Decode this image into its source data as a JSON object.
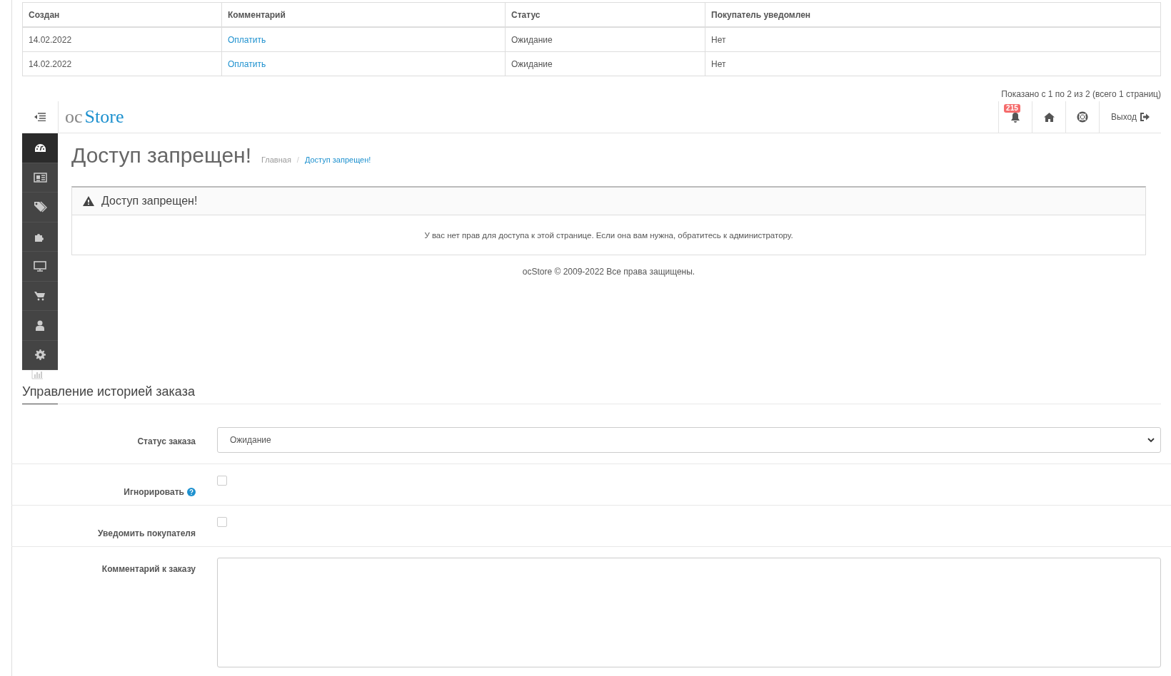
{
  "history_table": {
    "columns": [
      "Создан",
      "Комментарий",
      "Статус",
      "Покупатель уведомлен"
    ],
    "rows": [
      {
        "created": "14.02.2022",
        "comment": "Оплатить",
        "status": "Ожидание",
        "notified": "Нет"
      },
      {
        "created": "14.02.2022",
        "comment": "Оплатить",
        "status": "Ожидание",
        "notified": "Нет"
      }
    ]
  },
  "pagination_text": "Показано с 1 по 2 из 2 (всего 1 страниц)",
  "embedded_admin": {
    "logo": {
      "prefix": "oc",
      "name": "Store"
    },
    "notification_count": "215",
    "logout": "Выход",
    "sidebar_items": [
      {
        "kind": "dashboard",
        "selected": true
      },
      {
        "kind": "catalog",
        "selected": false
      },
      {
        "kind": "tags",
        "selected": false
      },
      {
        "kind": "extensions",
        "selected": false
      },
      {
        "kind": "design",
        "selected": false
      },
      {
        "kind": "sales",
        "selected": false
      },
      {
        "kind": "customers",
        "selected": false
      },
      {
        "kind": "settings",
        "selected": false
      }
    ],
    "page_title": "Доступ запрещен!",
    "breadcrumbs": [
      "Главная",
      "Доступ запрещен!"
    ],
    "breadcrumb_separator": "/",
    "alert": {
      "title": "Доступ запрещен!",
      "message": "У вас нет прав для доступа к этой странице. Если она вам нужна, обратитесь к администратору."
    },
    "footer": "ocStore © 2009-2022 Все права защищены."
  },
  "history_form": {
    "title": "Управление историей заказа",
    "fields": [
      {
        "kind": "select",
        "label": "Статус заказа",
        "value": "Ожидание"
      },
      {
        "kind": "checkbox",
        "label": "Игнорировать",
        "help": true,
        "checked": false
      },
      {
        "kind": "checkbox",
        "label": "Уведомить покупателя",
        "help": false,
        "checked": false
      },
      {
        "kind": "textarea",
        "label": "Комментарий к заказу"
      }
    ]
  }
}
